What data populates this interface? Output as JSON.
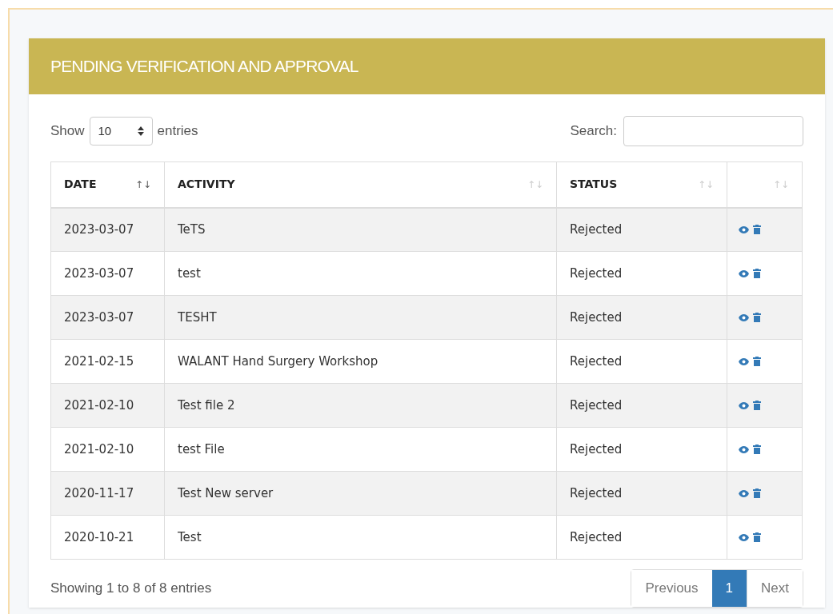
{
  "panel": {
    "title": "PENDING VERIFICATION AND APPROVAL"
  },
  "length_control": {
    "before": "Show",
    "value": "10",
    "after": "entries"
  },
  "search": {
    "label": "Search:"
  },
  "table": {
    "columns": [
      {
        "label": "DATE",
        "sort_glyph": "↑↓",
        "sorted": true
      },
      {
        "label": "ACTIVITY",
        "sort_glyph": "↑↓",
        "sorted": false
      },
      {
        "label": "STATUS",
        "sort_glyph": "↑↓",
        "sorted": false
      },
      {
        "sort_glyph": "↑↓",
        "sorted": false
      }
    ],
    "rows": [
      {
        "date": "2023-03-07",
        "activity": "TeTS",
        "status": "Rejected"
      },
      {
        "date": "2023-03-07",
        "activity": "test",
        "status": "Rejected"
      },
      {
        "date": "2023-03-07",
        "activity": "TESHT",
        "status": "Rejected"
      },
      {
        "date": "2021-02-15",
        "activity": "WALANT Hand Surgery Workshop",
        "status": "Rejected"
      },
      {
        "date": "2021-02-10",
        "activity": "Test file 2",
        "status": "Rejected"
      },
      {
        "date": "2021-02-10",
        "activity": "test File",
        "status": "Rejected"
      },
      {
        "date": "2020-11-17",
        "activity": "Test New server",
        "status": "Rejected"
      },
      {
        "date": "2020-10-21",
        "activity": "Test",
        "status": "Rejected"
      }
    ]
  },
  "info": "Showing 1 to 8 of 8 entries",
  "pagination": [
    {
      "label": "Previous",
      "selected": false
    },
    {
      "label": "1",
      "selected": true
    },
    {
      "label": "Next",
      "selected": false
    }
  ]
}
